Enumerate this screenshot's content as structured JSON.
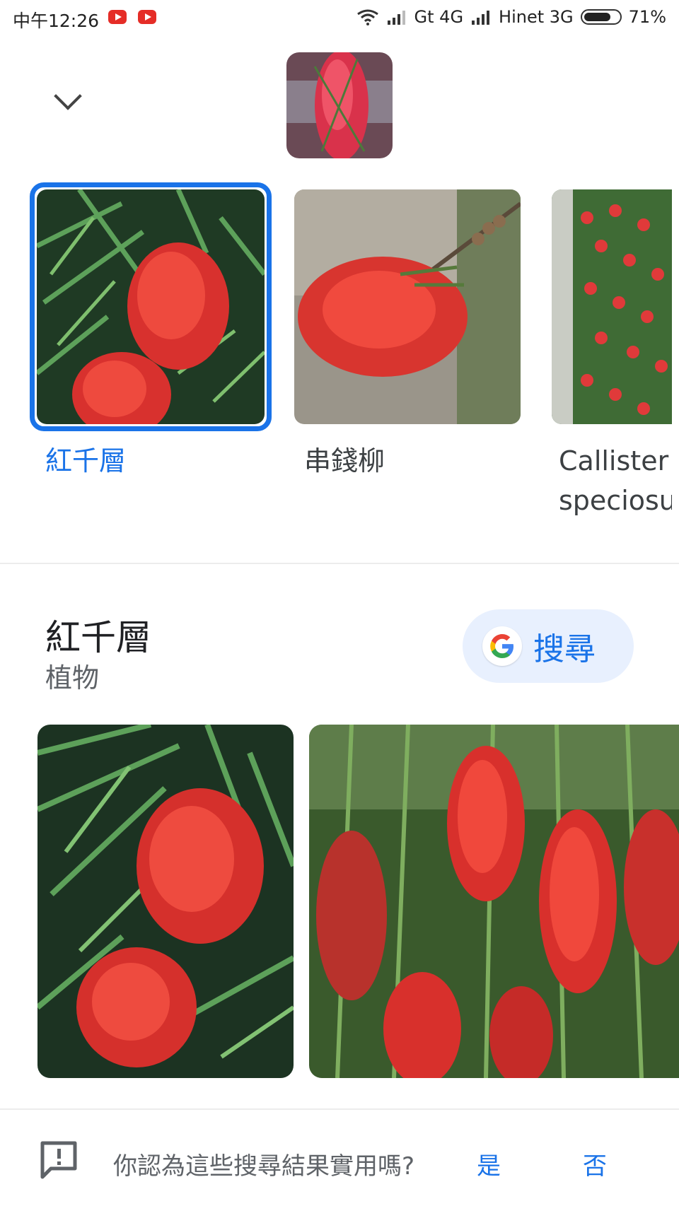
{
  "status_bar": {
    "time": "中午12:26",
    "carrier1": "Gt 4G",
    "carrier2": "Hinet 3G",
    "battery": "71%",
    "icons": [
      "youtube-icon",
      "youtube-icon",
      "wifi-icon",
      "signal-icon",
      "signal-icon",
      "battery-icon"
    ]
  },
  "header": {
    "collapse_icon": "chevron-down-icon"
  },
  "candidates": [
    {
      "label": "紅千層",
      "selected": true
    },
    {
      "label": "串錢柳",
      "selected": false
    },
    {
      "label": "Callistemon speciosus",
      "label_visible_line1": "Callister",
      "label_visible_line2": "speciosu",
      "selected": false
    }
  ],
  "entity": {
    "title": "紅千層",
    "subtitle": "植物",
    "search_label": "搜尋"
  },
  "feedback": {
    "question": "你認為這些搜尋結果實用嗎?",
    "yes": "是",
    "no": "否"
  },
  "colors": {
    "accent": "#1a73e8",
    "search_button_bg": "#e8f0fe",
    "divider": "#ececec"
  }
}
